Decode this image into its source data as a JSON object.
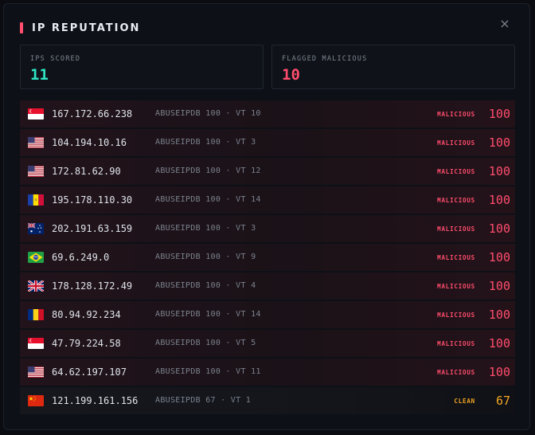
{
  "header": {
    "title": "IP REPUTATION",
    "close_glyph": "×"
  },
  "stats": {
    "scored_label": "IPS SCORED",
    "scored_value": "11",
    "flagged_label": "FLAGGED MALICIOUS",
    "flagged_value": "10"
  },
  "colors": {
    "malicious": "#ff4d6d",
    "clean": "#f5a623",
    "scored": "#2ee6c4",
    "accent": "#ff4d6d"
  },
  "rows": [
    {
      "flag": "singapore-flag-icon",
      "ip": "167.172.66.238",
      "sources": "ABUSEIPDB 100 · VT 10",
      "verdict": "MALICIOUS",
      "score": "100"
    },
    {
      "flag": "us-flag-icon",
      "ip": "104.194.10.16",
      "sources": "ABUSEIPDB 100 · VT 3",
      "verdict": "MALICIOUS",
      "score": "100"
    },
    {
      "flag": "us-flag-icon",
      "ip": "172.81.62.90",
      "sources": "ABUSEIPDB 100 · VT 12",
      "verdict": "MALICIOUS",
      "score": "100"
    },
    {
      "flag": "andorra-flag-icon",
      "ip": "195.178.110.30",
      "sources": "ABUSEIPDB 100 · VT 14",
      "verdict": "MALICIOUS",
      "score": "100"
    },
    {
      "flag": "australia-flag-icon",
      "ip": "202.191.63.159",
      "sources": "ABUSEIPDB 100 · VT 3",
      "verdict": "MALICIOUS",
      "score": "100"
    },
    {
      "flag": "brazil-flag-icon",
      "ip": "69.6.249.0",
      "sources": "ABUSEIPDB 100 · VT 9",
      "verdict": "MALICIOUS",
      "score": "100"
    },
    {
      "flag": "uk-flag-icon",
      "ip": "178.128.172.49",
      "sources": "ABUSEIPDB 100 · VT 4",
      "verdict": "MALICIOUS",
      "score": "100"
    },
    {
      "flag": "romania-flag-icon",
      "ip": "80.94.92.234",
      "sources": "ABUSEIPDB 100 · VT 14",
      "verdict": "MALICIOUS",
      "score": "100"
    },
    {
      "flag": "singapore-flag-icon",
      "ip": "47.79.224.58",
      "sources": "ABUSEIPDB 100 · VT 5",
      "verdict": "MALICIOUS",
      "score": "100"
    },
    {
      "flag": "us-flag-icon",
      "ip": "64.62.197.107",
      "sources": "ABUSEIPDB 100 · VT 11",
      "verdict": "MALICIOUS",
      "score": "100"
    },
    {
      "flag": "china-flag-icon",
      "ip": "121.199.161.156",
      "sources": "ABUSEIPDB 67 · VT 1",
      "verdict": "CLEAN",
      "score": "67"
    }
  ]
}
